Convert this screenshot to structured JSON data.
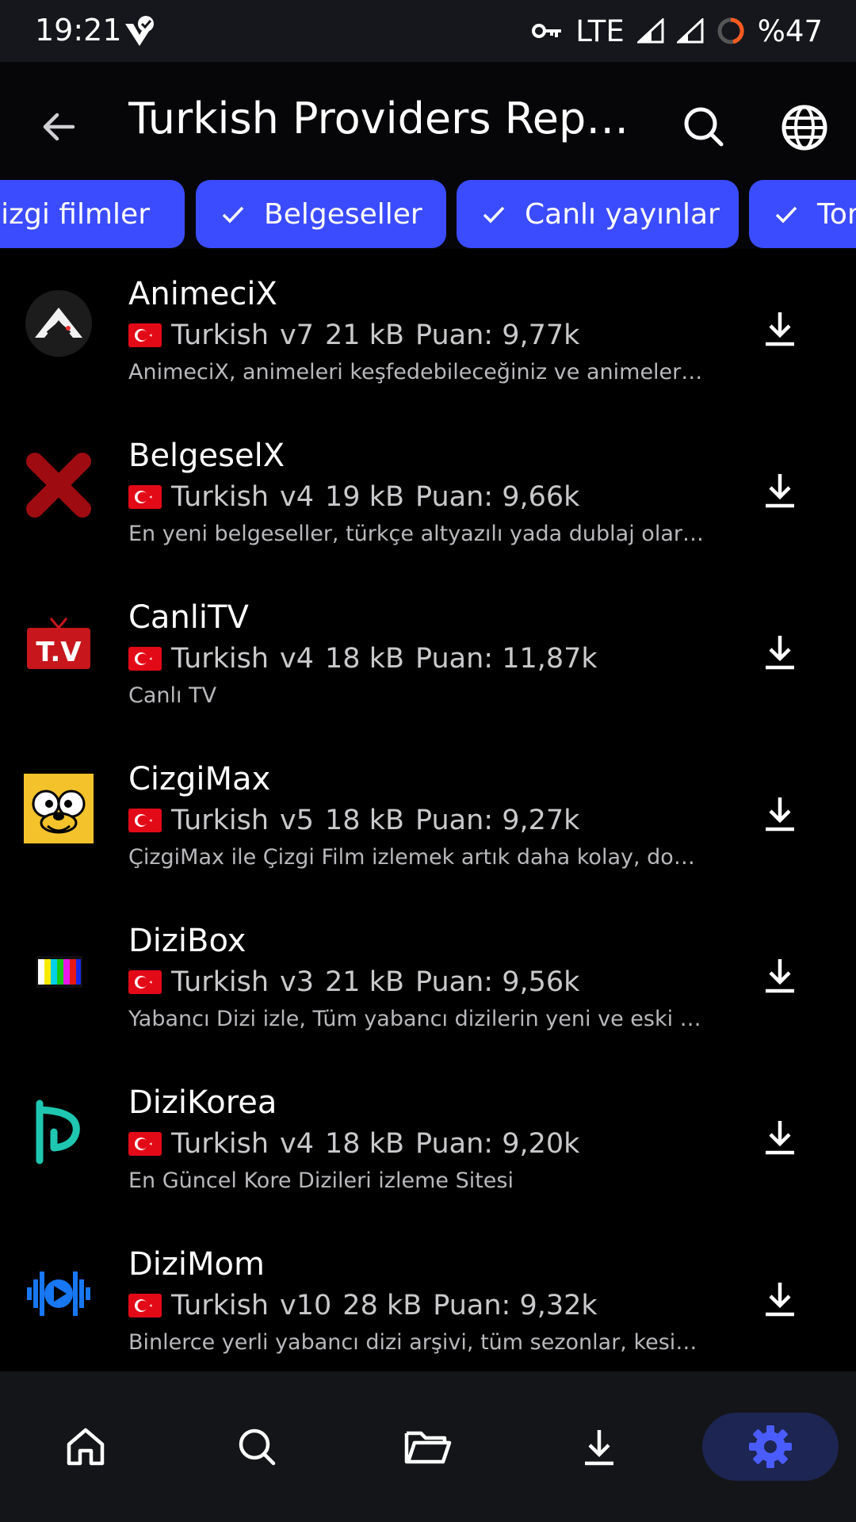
{
  "status_bar": {
    "time": "19:21",
    "network": "LTE",
    "battery": "%47"
  },
  "app_bar": {
    "title": "Turkish Providers Repository"
  },
  "chips": [
    {
      "label": "Çizgi filmler",
      "selected": true
    },
    {
      "label": "Belgeseller",
      "selected": true
    },
    {
      "label": "Canlı yayınlar",
      "selected": true
    },
    {
      "label": "Torrent",
      "selected": true
    }
  ],
  "providers": [
    {
      "name": "AnimeciX",
      "language": "Turkish",
      "version": "v7",
      "size": "21 kB",
      "score": "Puan: 9,77k",
      "description": "AnimeciX, animeleri keşfedebileceğiniz ve animeleri izleyebileceğiniz bir platform",
      "icon": "animecix-logo"
    },
    {
      "name": "BelgeselX",
      "language": "Turkish",
      "version": "v4",
      "size": "19 kB",
      "score": "Puan: 9,66k",
      "description": "En yeni belgeseller, türkçe altyazılı yada dublaj olarak izleyebilirsiniz",
      "icon": "belgeselx-logo"
    },
    {
      "name": "CanliTV",
      "language": "Turkish",
      "version": "v4",
      "size": "18 kB",
      "score": "Puan: 11,87k",
      "description": "Canlı TV",
      "icon": "canlitv-logo"
    },
    {
      "name": "CizgiMax",
      "language": "Turkish",
      "version": "v5",
      "size": "18 kB",
      "score": "Puan: 9,27k",
      "description": "ÇizgiMax ile Çizgi Film izlemek artık daha kolay, donmadan izleyin",
      "icon": "cizgimax-logo"
    },
    {
      "name": "DiziBox",
      "language": "Turkish",
      "version": "v3",
      "size": "21 kB",
      "score": "Puan: 9,56k",
      "description": "Yabancı Dizi izle, Tüm yabancı dizilerin yeni ve eski sezonlarını izleyin",
      "icon": "dizibox-logo"
    },
    {
      "name": "DiziKorea",
      "language": "Turkish",
      "version": "v4",
      "size": "18 kB",
      "score": "Puan: 9,20k",
      "description": "En Güncel Kore Dizileri izleme Sitesi",
      "icon": "dizikorea-logo"
    },
    {
      "name": "DiziMom",
      "language": "Turkish",
      "version": "v10",
      "size": "28 kB",
      "score": "Puan: 9,32k",
      "description": "Binlerce yerli yabancı dizi arşivi, tüm sezonlar, kesintisiz izleyin",
      "icon": "dizimom-logo"
    }
  ],
  "bottom_nav": [
    {
      "icon": "home-icon",
      "active": false
    },
    {
      "icon": "search-icon",
      "active": false
    },
    {
      "icon": "folder-icon",
      "active": false
    },
    {
      "icon": "download-icon",
      "active": false
    },
    {
      "icon": "settings-icon",
      "active": true
    }
  ],
  "colors": {
    "accent": "#3b4cff",
    "active_nav": "#4a5cff",
    "background": "#000000"
  }
}
